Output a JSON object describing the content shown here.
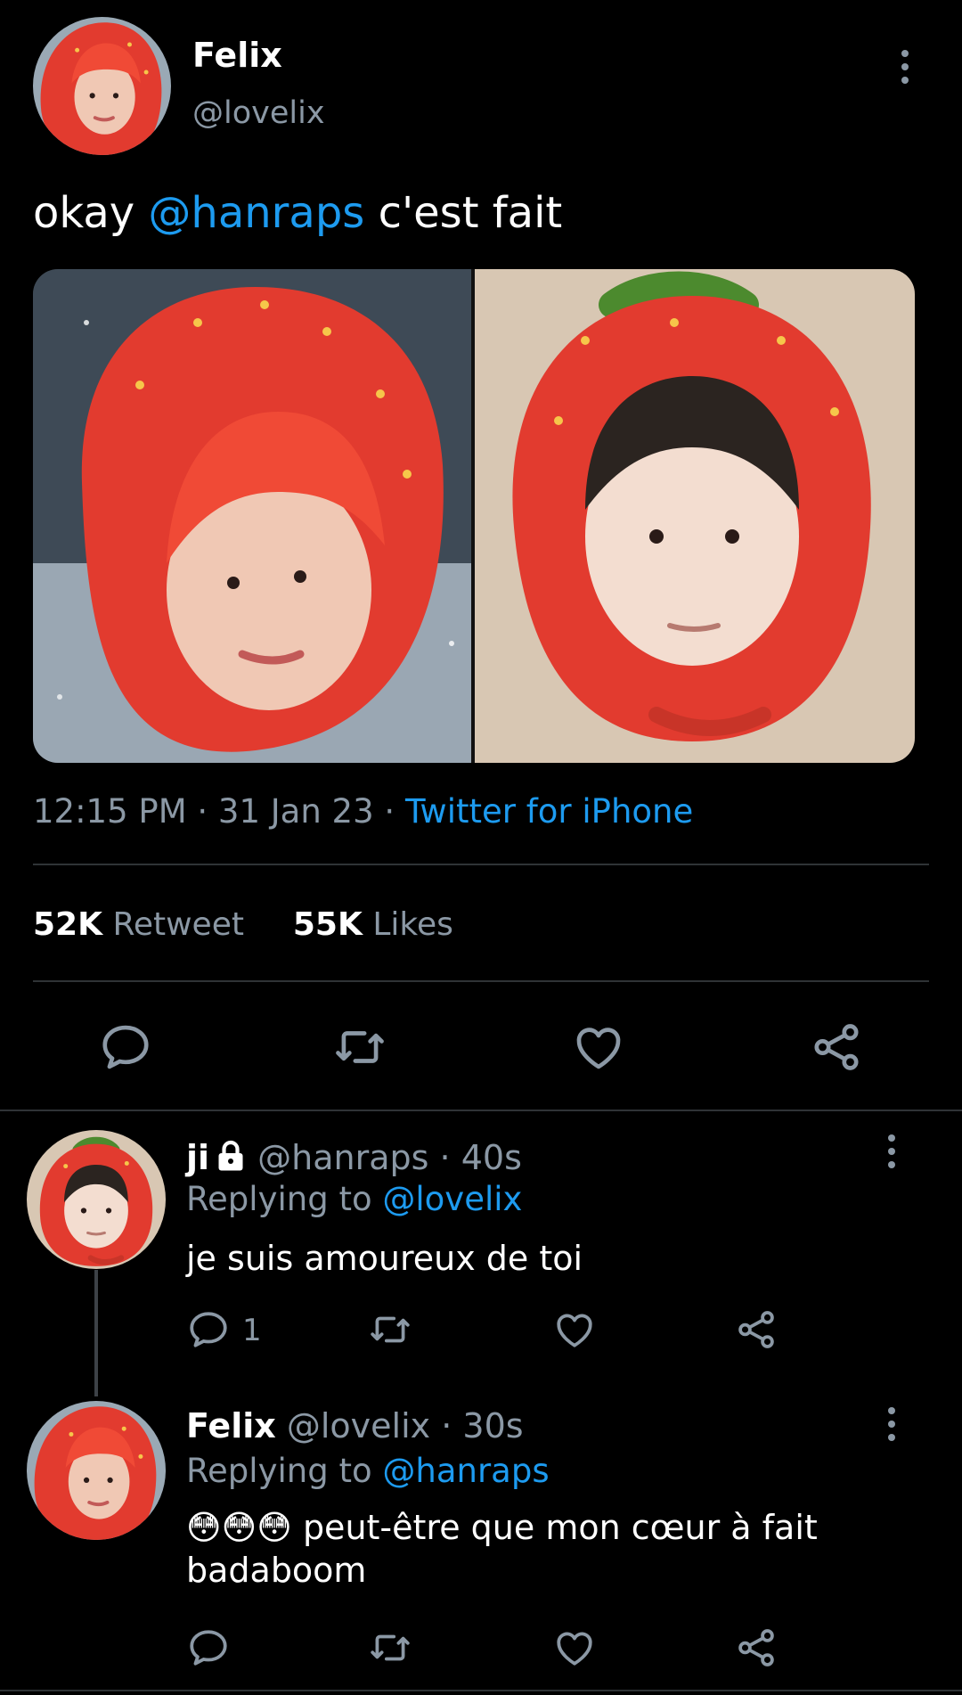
{
  "colors": {
    "background": "#000000",
    "text": "#e7e9ea",
    "muted": "#8b98a5",
    "link": "#1d9bf0",
    "divider": "#2f3336",
    "hat_red": "#e23b2f"
  },
  "main_tweet": {
    "author_name": "Felix",
    "author_handle": "@lovelix",
    "text_prefix": "okay",
    "mention": "@hanraps",
    "text_suffix": "c'est fait",
    "time": "12:15 PM",
    "date": "31 Jan 23",
    "source": "Twitter for iPhone",
    "separator": "·",
    "retweets_count": "52K",
    "retweets_label": "Retweet",
    "likes_count": "55K",
    "likes_label": "Likes",
    "icons": [
      "more-vertical-icon",
      "reply-icon",
      "retweet-icon",
      "like-icon",
      "share-icon"
    ]
  },
  "replies": [
    {
      "author_name": "ji",
      "author_handle": "@hanraps",
      "time": "40s",
      "replying_prefix": "Replying to",
      "replying_to": "@lovelix",
      "text": "je suis amoureux de toi",
      "reply_count": "1"
    },
    {
      "author_name": "Felix",
      "author_handle": "@lovelix",
      "time": "30s",
      "replying_prefix": "Replying to",
      "replying_to": "@hanraps",
      "emojis": "😳😳😳",
      "text_line1": "peut-être que mon cœur à fait",
      "text_line2": "badaboom",
      "reply_count": ""
    }
  ]
}
